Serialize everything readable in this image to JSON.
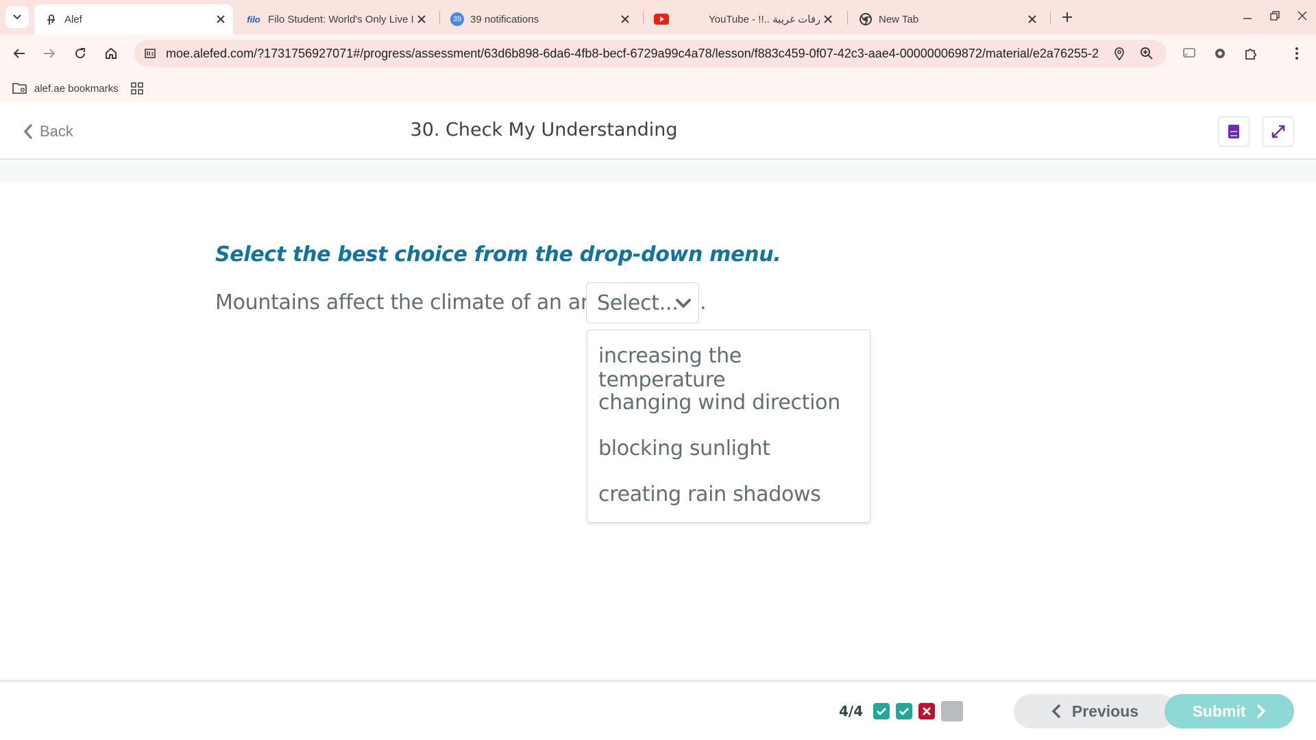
{
  "browser": {
    "tabs": [
      {
        "title": "Alef",
        "active": true,
        "icon": "alef-icon"
      },
      {
        "title": "Filo Student: World's Only Live I",
        "active": false,
        "icon": "filo-icon",
        "icon_text": "filo"
      },
      {
        "title": "39 notifications",
        "active": false,
        "icon": "notification-badge-icon",
        "badge": "39"
      },
      {
        "title": "YouTube - !!.. تصرفات غريبة",
        "active": false,
        "icon": "youtube-icon"
      },
      {
        "title": "New Tab",
        "active": false,
        "icon": "chrome-icon"
      }
    ],
    "url": "moe.alefed.com/?1731756927071#/progress/assessment/63d6b898-6da6-4fb8-becf-6729a99c4a78/lesson/f883c459-0f07-42c3-aae4-000000069872/material/e2a76255-2...",
    "bookmarks": [
      {
        "label": "alef.ae bookmarks",
        "icon": "bookmark-folder-icon"
      }
    ],
    "colors": {
      "tabstrip": "#fbe4df"
    }
  },
  "app": {
    "back_label": "Back",
    "page_title": "30. Check My Understanding",
    "instruction": "Select the best choice from the drop-down menu.",
    "question_text": "Mountains affect the climate of an area by",
    "question_suffix": ".",
    "select_placeholder": "Select...",
    "options": [
      "increasing the temperature",
      "changing wind direction",
      "blocking sunlight",
      "creating rain shadows"
    ],
    "colors": {
      "instruction": "#11739f",
      "body_text": "#616e75",
      "correct": "#26a69a",
      "incorrect": "#c0102f",
      "pending": "#b8bcbe"
    }
  },
  "footer": {
    "progress": "4/4",
    "question_status": [
      "correct",
      "correct",
      "incorrect",
      "pending"
    ],
    "previous_label": "Previous",
    "submit_label": "Submit"
  }
}
